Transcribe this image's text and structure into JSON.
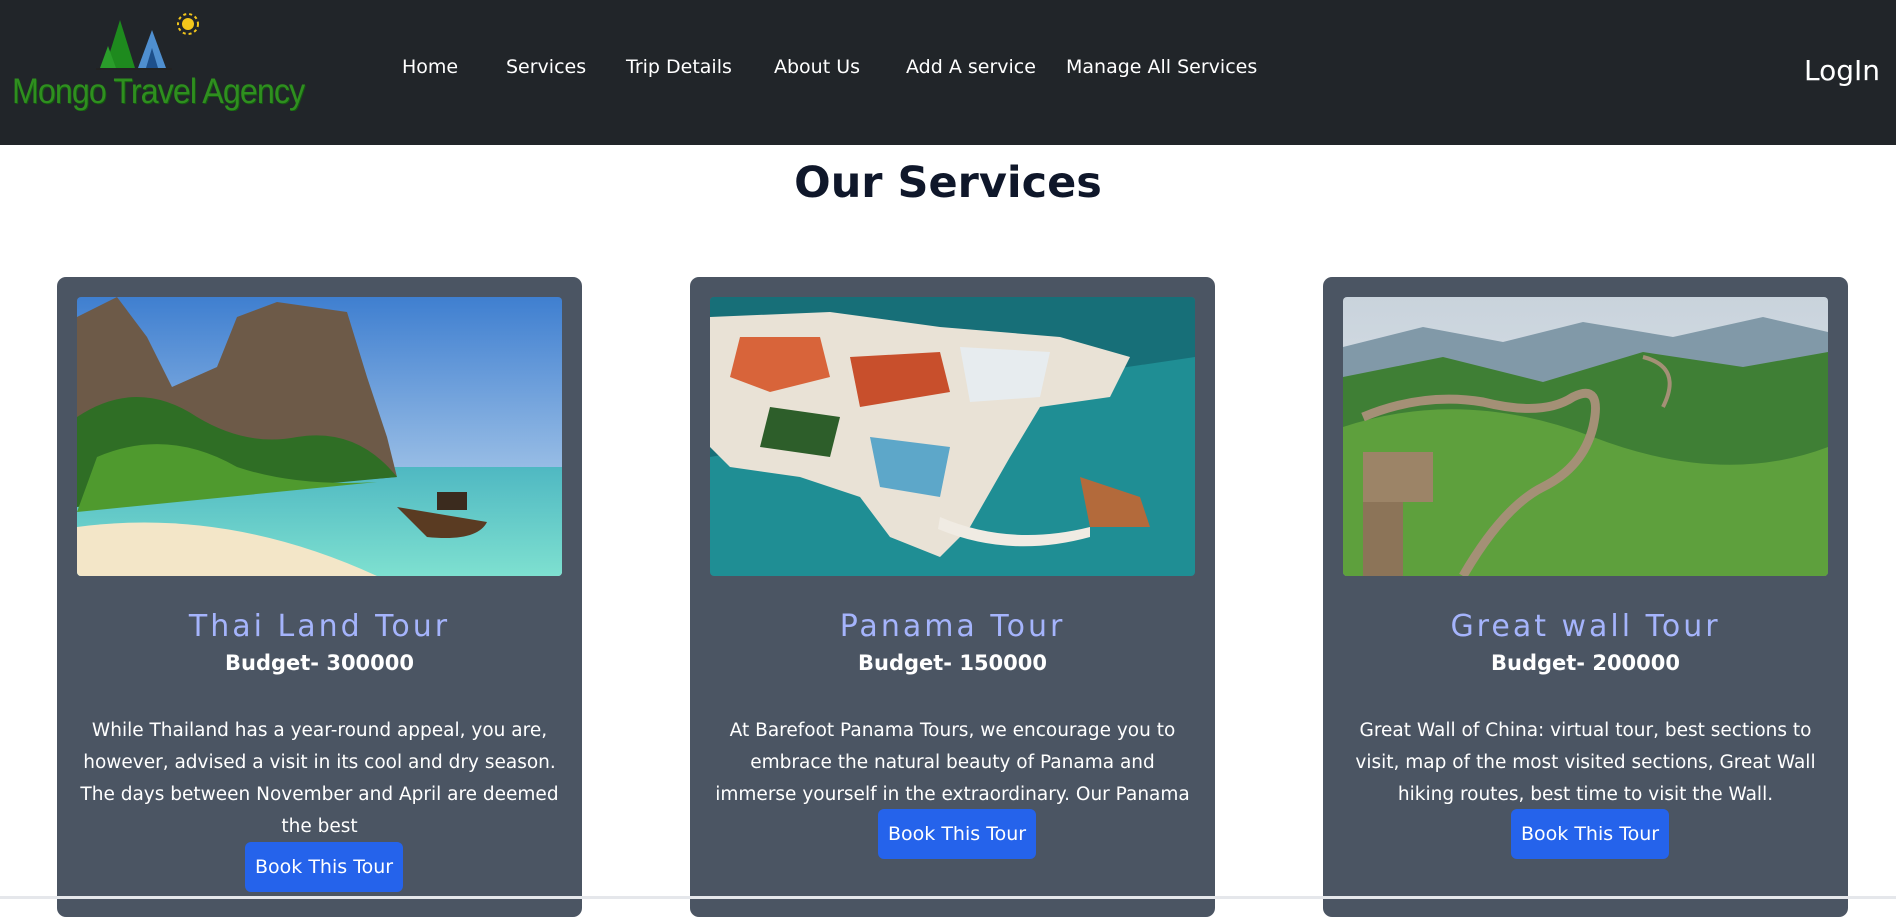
{
  "brand": {
    "name": "Mongo Travel Agency"
  },
  "nav": {
    "links": [
      {
        "label": "Home"
      },
      {
        "label": "Services"
      },
      {
        "label": "Trip Details"
      },
      {
        "label": "About Us"
      },
      {
        "label": "Add A service"
      },
      {
        "label": "Manage All Services"
      }
    ],
    "login_label": "LogIn"
  },
  "page": {
    "title": "Our Services"
  },
  "services": [
    {
      "title": "Thai Land Tour",
      "budget": "Budget- 300000",
      "description": "While Thailand has a year-round appeal, you are, however, advised a visit in its cool and dry season. The days between November and April are deemed the best",
      "button_label": "Book This Tour",
      "image_icon": "beach-longboat-image"
    },
    {
      "title": "Panama Tour",
      "budget": "Budget- 150000",
      "description": "At Barefoot Panama Tours, we encourage you to embrace the natural beauty of Panama and immerse yourself in the extraordinary. Our Panama Tours",
      "button_label": "Book This Tour",
      "image_icon": "peninsula-city-image"
    },
    {
      "title": "Great wall Tour",
      "budget": "Budget- 200000",
      "description": "Great Wall of China: virtual tour, best sections to visit, map of the most visited sections, Great Wall hiking routes, best time to visit the Wall.",
      "button_label": "Book This Tour",
      "image_icon": "great-wall-image"
    }
  ],
  "colors": {
    "navbar": "#212529",
    "card": "#4b5563",
    "card_title": "#a5b4fc",
    "button": "#2563eb",
    "brand_green": "#2f8f1f"
  }
}
